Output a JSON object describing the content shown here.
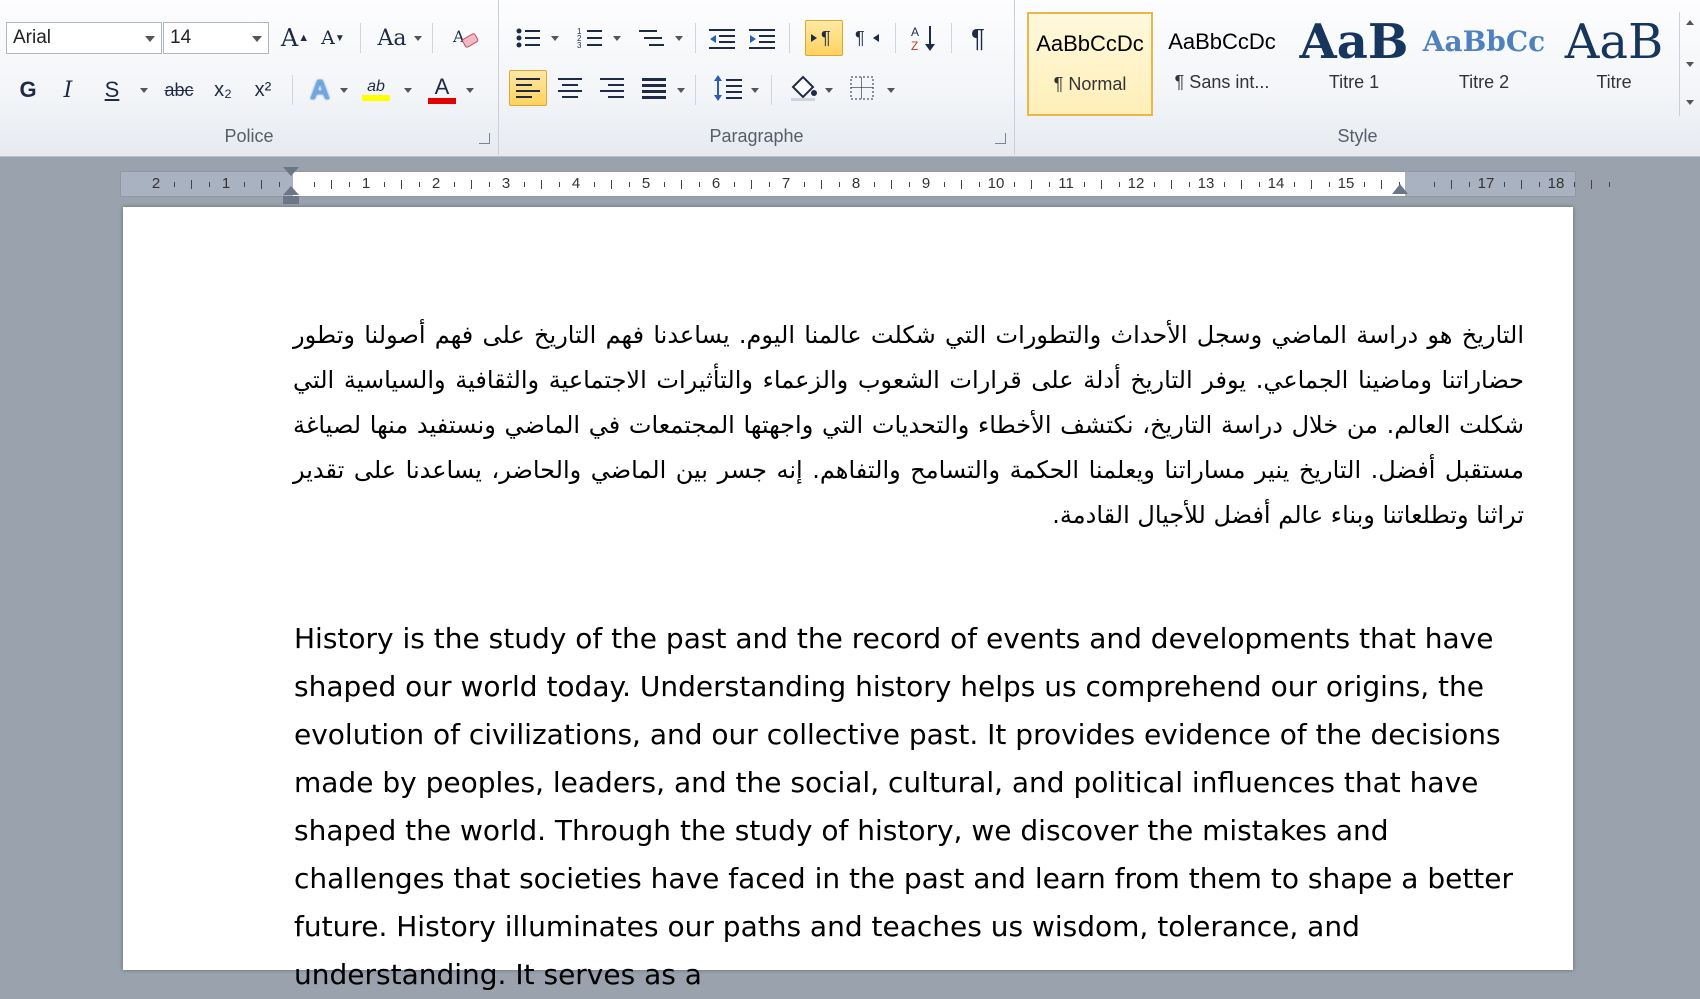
{
  "ribbon": {
    "font_group": {
      "label": "Police",
      "font_name": "Arial",
      "font_size": "14",
      "grow_label": "A",
      "shrink_label": "A",
      "case_label": "Aa",
      "bold": "G",
      "italic": "I",
      "underline": "S",
      "strike": "abc",
      "subscript": "x₂",
      "superscript": "x²",
      "text_effect": "A",
      "highlight": "ab",
      "font_color": "A"
    },
    "paragraph_group": {
      "label": "Paragraphe",
      "pilcrow": "¶",
      "sort_label": "A↓Z"
    },
    "styles_group": {
      "label": "Style",
      "tiles": [
        {
          "sample": "AaBbCcDc",
          "name": "¶ Normal"
        },
        {
          "sample": "AaBbCcDc",
          "name": "¶ Sans int..."
        },
        {
          "sample": "AaB",
          "name": "Titre 1"
        },
        {
          "sample": "AaBbCc",
          "name": "Titre 2"
        },
        {
          "sample": "AaB",
          "name": "Titre"
        }
      ]
    }
  },
  "ruler": {
    "labels": [
      "2",
      "1",
      "",
      "1",
      "2",
      "3",
      "4",
      "5",
      "6",
      "7",
      "8",
      "9",
      "10",
      "11",
      "12",
      "13",
      "14",
      "15",
      "",
      "17",
      "18"
    ]
  },
  "document": {
    "arabic_paragraph": "التاريخ هو دراسة الماضي وسجل الأحداث والتطورات التي شكلت عالمنا اليوم. يساعدنا فهم التاريخ على فهم أصولنا وتطور حضاراتنا وماضينا الجماعي. يوفر التاريخ أدلة على قرارات الشعوب والزعماء والتأثيرات الاجتماعية والثقافية والسياسية التي شكلت العالم. من خلال دراسة التاريخ، نكتشف الأخطاء والتحديات التي واجهتها المجتمعات في الماضي ونستفيد منها لصياغة مستقبل أفضل. التاريخ ينير مساراتنا ويعلمنا الحكمة والتسامح والتفاهم. إنه جسر بين الماضي والحاضر، يساعدنا على تقدير تراثنا وتطلعاتنا وبناء عالم أفضل للأجيال القادمة.",
    "english_paragraph": "History is the study of the past and the record of events and developments that have shaped our world today. Understanding history helps us comprehend our origins, the evolution of civilizations, and our collective past. It provides evidence of the decisions made by peoples, leaders, and the social, cultural, and political influences that have shaped the world. Through the study of history, we discover the mistakes and challenges that societies have faced in the past and learn from them to shape a better future. History illuminates our paths and teaches us wisdom, tolerance, and understanding. It serves as a"
  },
  "colors": {
    "highlight_bar": "#ffff00",
    "font_color_bar": "#e00000",
    "selected_tile_border": "#e8b84a",
    "titre2_color": "#4f81bd",
    "titre1_color": "#17365d"
  }
}
